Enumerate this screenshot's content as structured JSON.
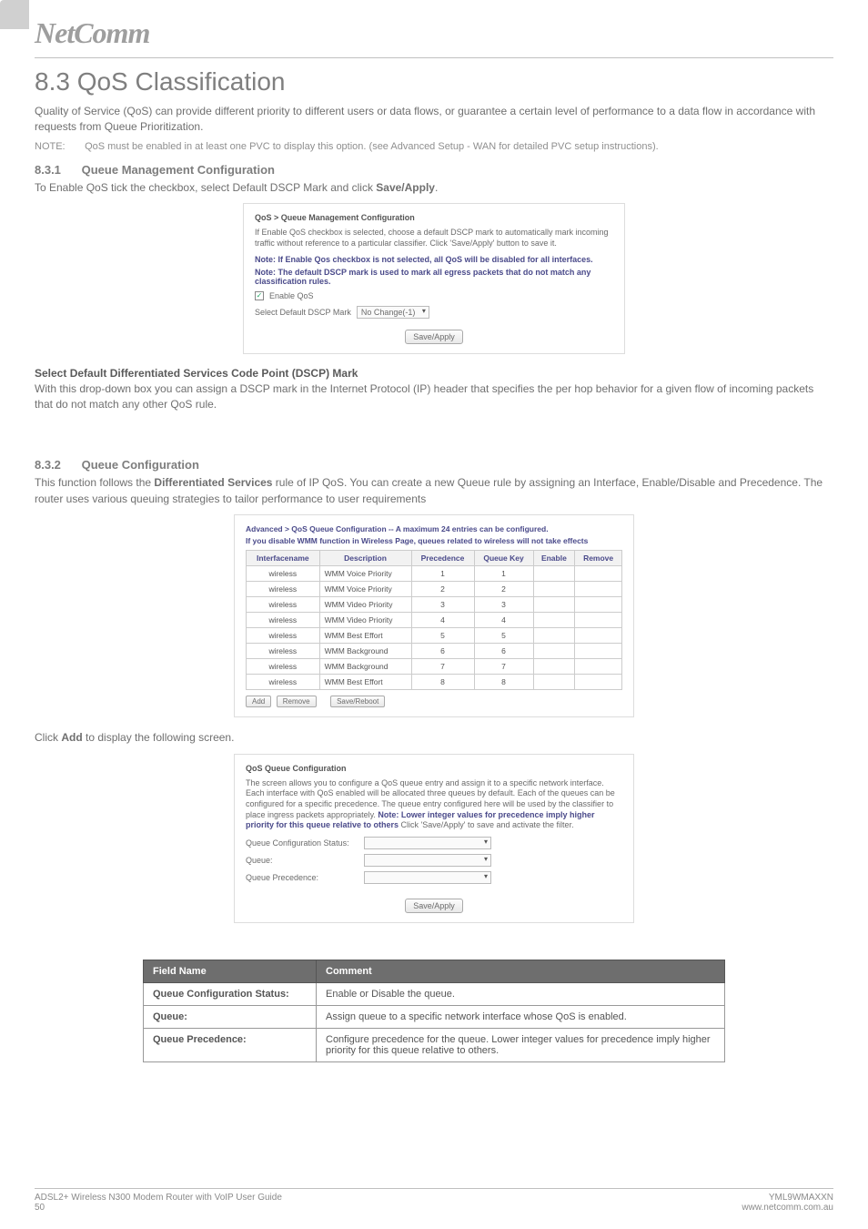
{
  "brand": {
    "logo": "NetComm"
  },
  "headings": {
    "h1": "8.3 QoS Classification",
    "h2a_num": "8.3.1",
    "h2a": "Queue Management Configuration",
    "h2b_num": "8.3.2",
    "h2b": "Queue Configuration",
    "dscp_title": "Select Default Differentiated Services Code Point (DSCP) Mark"
  },
  "paras": {
    "intro": "Quality of Service (QoS) can provide different priority to different users or data flows, or guarantee a certain level of performance to a data flow in accordance with requests from Queue Prioritization.",
    "note_label": "NOTE:",
    "note_text": "QoS must be enabled in at least one PVC to display this option. (see Advanced Setup - WAN for detailed PVC setup instructions).",
    "enable_line_a": "To Enable QoS tick the checkbox, select Default DSCP Mark and click ",
    "enable_line_b": "Save/Apply",
    "enable_line_c": ".",
    "dscp_body": "With this drop-down box you can assign a DSCP mark in the Internet Protocol (IP) header that specifies the per hop behavior for a given flow of incoming packets that do not match any other QoS rule.",
    "qconf_a": "This function follows the ",
    "qconf_b": "Differentiated Services",
    "qconf_c": " rule of IP QoS. You can create a new Queue rule by assigning an Interface, Enable/Disable and Precedence. The router uses various queuing strategies to tailor performance to user requirements",
    "click_add_a": "Click ",
    "click_add_b": "Add",
    "click_add_c": " to display the following screen."
  },
  "ss1": {
    "title": "QoS > Queue Management Configuration",
    "text": "If Enable QoS checkbox is selected, choose a default DSCP mark to automatically mark incoming traffic without reference to a particular classifier. Click 'Save/Apply' button to save it.",
    "note1": "Note: If Enable Qos checkbox is not selected, all QoS will be disabled for all interfaces.",
    "note2": "Note: The default DSCP mark is used to mark all egress packets that do not match any classification rules.",
    "checkbox": "Enable QoS",
    "dscp_label": "Select Default DSCP Mark",
    "dscp_value": "No Change(-1)",
    "btn": "Save/Apply"
  },
  "ss2": {
    "header1": "Advanced > QoS Queue Configuration -- A maximum 24 entries can be configured.",
    "header2": "If you disable WMM function in Wireless Page, queues related to wireless will not take effects",
    "cols": [
      "Interfacename",
      "Description",
      "Precedence",
      "Queue Key",
      "Enable",
      "Remove"
    ],
    "rows": [
      {
        "iface": "wireless",
        "desc": "WMM Voice Priority",
        "prec": "1",
        "key": "1"
      },
      {
        "iface": "wireless",
        "desc": "WMM Voice Priority",
        "prec": "2",
        "key": "2"
      },
      {
        "iface": "wireless",
        "desc": "WMM Video Priority",
        "prec": "3",
        "key": "3"
      },
      {
        "iface": "wireless",
        "desc": "WMM Video Priority",
        "prec": "4",
        "key": "4"
      },
      {
        "iface": "wireless",
        "desc": "WMM Best Effort",
        "prec": "5",
        "key": "5"
      },
      {
        "iface": "wireless",
        "desc": "WMM Background",
        "prec": "6",
        "key": "6"
      },
      {
        "iface": "wireless",
        "desc": "WMM Background",
        "prec": "7",
        "key": "7"
      },
      {
        "iface": "wireless",
        "desc": "WMM Best Effort",
        "prec": "8",
        "key": "8"
      }
    ],
    "btn_add": "Add",
    "btn_remove": "Remove",
    "btn_save": "Save/Reboot"
  },
  "ss3": {
    "title": "QoS Queue Configuration",
    "text": "The screen allows you to configure a QoS queue entry and assign it to a specific network interface. Each interface with QoS enabled will be allocated three queues by default. Each of the queues can be configured for a specific precedence. The queue entry configured here will be used by the classifier to place ingress packets appropriately. ",
    "strong": "Note: Lower integer values for precedence imply higher priority for this queue relative to others",
    "tail": " Click 'Save/Apply' to save and activate the filter.",
    "labels": {
      "status": "Queue Configuration Status:",
      "queue": "Queue:",
      "precedence": "Queue Precedence:"
    },
    "btn": "Save/Apply"
  },
  "field_table": {
    "cols": [
      "Field Name",
      "Comment"
    ],
    "rows": [
      {
        "name": "Queue Configuration Status:",
        "comment": "Enable or Disable the queue."
      },
      {
        "name": "Queue:",
        "comment": "Assign queue to a specific network interface whose QoS is enabled."
      },
      {
        "name": "Queue Precedence:",
        "comment": "Configure precedence for the queue. Lower integer values for precedence imply higher priority for this queue relative to others."
      }
    ]
  },
  "footer": {
    "left1": "ADSL2+ Wireless N300 Modem Router with VoIP User Guide",
    "left2": "50",
    "right1": "YML9WMAXXN",
    "right2": "www.netcomm.com.au"
  }
}
